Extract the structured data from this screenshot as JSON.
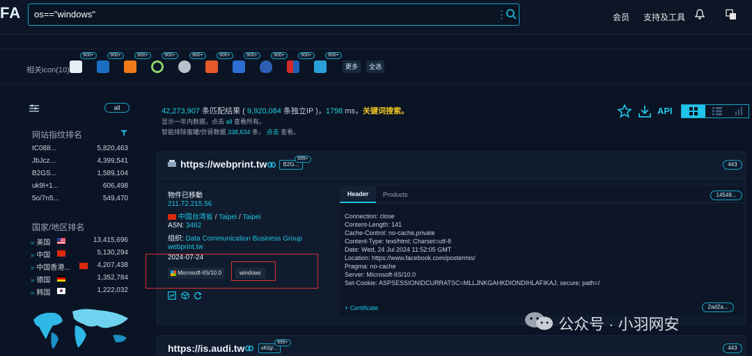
{
  "logo": "FA",
  "search": {
    "value": "os==\"windows\""
  },
  "nav": {
    "member": "会员",
    "support": "支持及工具"
  },
  "icon_row": {
    "label": "相关icon(10):",
    "badge": "900+",
    "more": "更多",
    "all": "全选"
  },
  "sidebar": {
    "all_pill": "all",
    "site_rank_title": "网站指纹排名",
    "site_rank": [
      {
        "name": "tC088...",
        "count": "5,820,463"
      },
      {
        "name": "JbJcz...",
        "count": "4,399,541"
      },
      {
        "name": "B2GS...",
        "count": "1,589,104"
      },
      {
        "name": "uk9l+1...",
        "count": "606,498"
      },
      {
        "name": "5o/7n5...",
        "count": "549,470"
      }
    ],
    "country_rank_title": "国家/地区排名",
    "country_rank": [
      {
        "name": "美国",
        "count": "13,415,696"
      },
      {
        "name": "中国",
        "count": "5,130,294"
      },
      {
        "name": "中国香港...",
        "count": "4,207,438"
      },
      {
        "name": "德国",
        "count": "1,352,784"
      },
      {
        "name": "韩国",
        "count": "1,222,032"
      }
    ]
  },
  "summary": {
    "results": "42,273,907",
    "results_label": " 条匹配结果 ( ",
    "unique_ip": "9,920,084",
    "unique_label": " 条独立IP )，",
    "time": "1798",
    "time_unit": " ms，",
    "keyword": "关键词搜索。",
    "line2_a": "显示一年内数据，点击 ",
    "line2_link": "all",
    "line2_b": " 查看所有。",
    "line3_a": "智能排除蜜罐/仿冒数据 ",
    "line3_count": "338,634",
    "line3_b": " 条， ",
    "line3_link": "点击",
    "line3_c": " 查看。",
    "api": "API"
  },
  "result": {
    "url": "https://webprint.tw",
    "badge_tag": "B2G...",
    "badge_num": "999+",
    "count": "443",
    "title": "物件已移動",
    "ip": "211.72.215.56",
    "region": "中国台湾省",
    "sep": "/",
    "city1": "Taipei",
    "city2": "Taipei",
    "asn_label": "ASN: ",
    "asn": "3462",
    "org_label": "组织: ",
    "org": "Data Communication Business Group",
    "domain": "webprint.tw",
    "date": "2024-07-24",
    "tag1": "Microsoft-IIS/10.0",
    "tag2": "windows",
    "tabs": [
      "Header",
      "Products"
    ],
    "hash_pill": "14548...",
    "headers": [
      "Connection: close",
      "Content-Length: 141",
      "Cache-Control: no-cache,private",
      "Content-Type: text/html; Charset=utf-8",
      "Date: Wed, 24 Jul 2024 11:52:05 GMT",
      "Location: https://www.facebook.com/postermis/",
      "Pragma: no-cache",
      "Server: Microsoft-IIS/10.0",
      "Set-Cookie: ASPSESSIONIDCURRATSC=MLLJNKGAHKDIONDIHLAFIKAJ; secure; path=/"
    ],
    "certificate": "+ Certificate",
    "cert_pill": "2ad2a..."
  },
  "result2": {
    "url": "https://is.audi.tw",
    "badge_tag": "vKbj/...",
    "badge_num": "999+",
    "count": "443"
  },
  "watermark": "公众号 · 小羽网安"
}
